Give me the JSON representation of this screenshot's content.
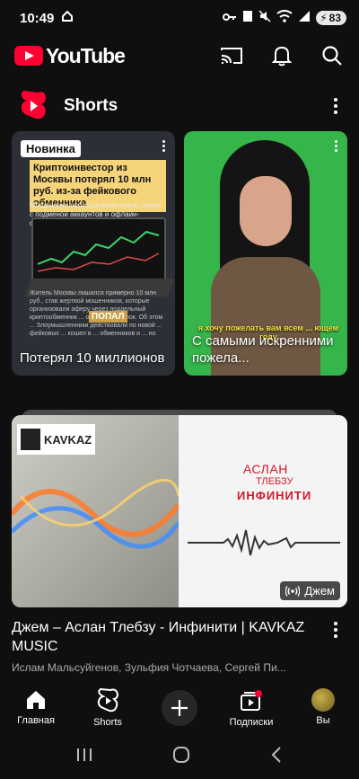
{
  "statusbar": {
    "time": "10:49",
    "battery": "83"
  },
  "header": {
    "brand": "YouTube"
  },
  "shorts": {
    "section_title": "Shorts",
    "items": [
      {
        "title": "Потерял 10 миллионов",
        "badge": "Новинка",
        "headline": "Криптоинвестор из Москвы потерял 10 млн руб. из-за фейкового обменника",
        "subline": "Мошенники использовали новую схему с подменой аккаунтов и офлайн-сделками",
        "body": "Житель Москвы лишился примерно 10 млн руб., став жертвой мошенников, которые организовали аферу через поддельный криптообменник ... офис для сделок. Об этом ... Злоумышленники действовали по новой ... фейковых ... кошел в ... обменников и ... но",
        "sticker": "ПОПАЛ"
      },
      {
        "title": "С самыми искренними пожела...",
        "overlay": "я хочу пожелать вам всем ... ющем году"
      }
    ]
  },
  "video": {
    "title": "Джем – Аслан Тлебзу - Инфинити | KAVKAZ MUSIC",
    "meta": "Ислам Мальсуйгенов, Зульфия Чотчаева, Сергей Пи...",
    "badge": "Джем",
    "thumb_label": "KAVKAZ",
    "thumb_artist_line1": "АСЛАН",
    "thumb_artist_line2": "ТЛЕБЗУ",
    "thumb_song": "ИНФИНИТИ"
  },
  "bottom_nav": {
    "home": "Главная",
    "shorts": "Shorts",
    "subscriptions": "Подписки",
    "you": "Вы"
  },
  "colors": {
    "background": "#0f0f0f",
    "brand_red": "#ff0033"
  }
}
